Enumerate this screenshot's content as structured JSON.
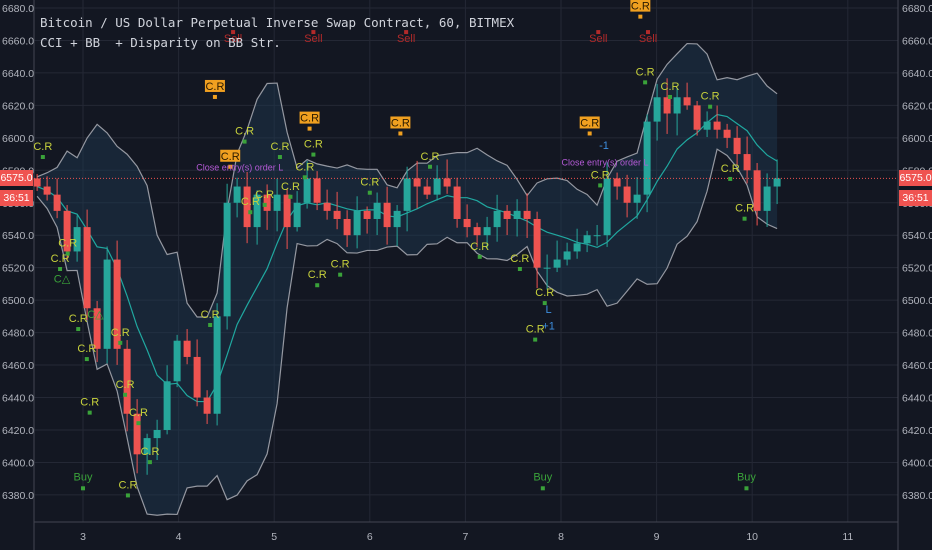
{
  "header": {
    "title": "Bitcoin / US Dollar Perpetual Inverse Swap Contract, 60, BITMEX",
    "indicator": "CCI + BB  + Disparity on BB Str."
  },
  "price_badge": {
    "price": "6575.0",
    "countdown": "36:51"
  },
  "colors": {
    "background": "#131722",
    "grid": "#242835",
    "up": "#26a69a",
    "down": "#ef5350",
    "band": "#9598a1",
    "band_fill": "#1e3a52",
    "basis": "#20a8a0",
    "cr": "#c8d23c",
    "cr_box": "#f0a020",
    "buy": "#3aa23a",
    "sell": "#b32a2a",
    "close_order": "#b45ad6",
    "last_price_line": "#ef5350"
  },
  "chart_data": {
    "type": "candlestick",
    "title": "Bitcoin / US Dollar Perpetual Inverse Swap Contract, 60, BITMEX",
    "xlabel": "",
    "ylabel": "",
    "ylim": [
      6370,
      6690
    ],
    "xlim": [
      2.52,
      11.6
    ],
    "y_ticks": [
      "6380.0",
      "6400.0",
      "6420.0",
      "6440.0",
      "6460.0",
      "6480.0",
      "6500.0",
      "6520.0",
      "6540.0",
      "6560.0",
      "6580.0",
      "6600.0",
      "6620.0",
      "6640.0",
      "6660.0",
      "6680.0"
    ],
    "x_ticks": [
      "3",
      "4",
      "5",
      "6",
      "7",
      "8",
      "9",
      "10",
      "11"
    ],
    "grid": true,
    "start_day": 2.52,
    "step_day": 0.1046,
    "first_open": 6575,
    "closes": [
      6570,
      6565,
      6555,
      6530,
      6545,
      6495,
      6470,
      6525,
      6470,
      6430,
      6405,
      6415,
      6420,
      6450,
      6475,
      6465,
      6440,
      6430,
      6490,
      6560,
      6570,
      6545,
      6565,
      6555,
      6565,
      6545,
      6560,
      6575,
      6560,
      6555,
      6550,
      6540,
      6555,
      6550,
      6560,
      6545,
      6555,
      6575,
      6570,
      6565,
      6575,
      6570,
      6550,
      6545,
      6540,
      6545,
      6555,
      6550,
      6555,
      6550,
      6520,
      6520,
      6525,
      6530,
      6535,
      6540,
      6540,
      6575,
      6570,
      6560,
      6565,
      6610,
      6625,
      6615,
      6625,
      6620,
      6605,
      6610,
      6605,
      6600,
      6590,
      6580,
      6555,
      6570,
      6575
    ],
    "bollinger": {
      "period": 8,
      "mult": 2
    },
    "last_price": 6575.0,
    "annotations": [
      {
        "type": "cr",
        "text": "C.R",
        "day": 2.58,
        "price": 6592.5
      },
      {
        "type": "cr",
        "text": "C.R",
        "day": 3.07,
        "price": 6435
      },
      {
        "type": "cr",
        "text": "C.R",
        "day": 2.76,
        "price": 6523.5
      },
      {
        "type": "cr",
        "text": "C.R",
        "day": 2.84,
        "price": 6533
      },
      {
        "type": "cr",
        "text": "C.R",
        "day": 3.04,
        "price": 6468
      },
      {
        "type": "cr",
        "text": "C.R",
        "day": 2.95,
        "price": 6486.5
      },
      {
        "type": "cr",
        "text": "C.R",
        "day": 3.39,
        "price": 6478
      },
      {
        "type": "cr",
        "text": "C.R",
        "day": 3.44,
        "price": 6446
      },
      {
        "type": "cr",
        "text": "C.R",
        "day": 3.58,
        "price": 6428.5
      },
      {
        "type": "cr",
        "text": "C.R",
        "day": 3.7,
        "price": 6404.5
      },
      {
        "type": "cr",
        "text": "C.R",
        "day": 3.47,
        "price": 6384
      },
      {
        "type": "cr",
        "text": "C.R",
        "day": 4.69,
        "price": 6602
      },
      {
        "type": "cr",
        "text": "C.R",
        "day": 5.06,
        "price": 6592.5
      },
      {
        "type": "cr",
        "text": "C.R",
        "day": 5.41,
        "price": 6594
      },
      {
        "type": "cr",
        "text": "C.R",
        "day": 5.45,
        "price": 6513.5
      },
      {
        "type": "cr",
        "text": "C.R",
        "day": 5.69,
        "price": 6520
      },
      {
        "type": "cr",
        "text": "C.R",
        "day": 6.0,
        "price": 6570.5
      },
      {
        "type": "cr",
        "text": "C.R",
        "day": 6.63,
        "price": 6586.5
      },
      {
        "type": "cr",
        "text": "C.R",
        "day": 7.15,
        "price": 6531
      },
      {
        "type": "cr",
        "text": "C.R",
        "day": 7.73,
        "price": 6480
      },
      {
        "type": "cr",
        "text": "C.R",
        "day": 7.83,
        "price": 6502.5
      },
      {
        "type": "cr",
        "text": "C.R",
        "day": 7.57,
        "price": 6523.5
      },
      {
        "type": "cr",
        "text": "C.R",
        "day": 9.77,
        "price": 6579
      },
      {
        "type": "cr",
        "text": "C.R",
        "day": 9.92,
        "price": 6554.5
      },
      {
        "type": "cr",
        "text": "C.R",
        "day": 9.14,
        "price": 6629.5
      },
      {
        "type": "cr",
        "text": "C.R",
        "day": 9.56,
        "price": 6623.5
      },
      {
        "type": "cr",
        "text": "C.R",
        "day": 8.88,
        "price": 6638.5
      },
      {
        "type": "cr",
        "text": "C.R",
        "day": 8.41,
        "price": 6575
      },
      {
        "type": "cr",
        "text": "C.R",
        "day": 4.9,
        "price": 6563
      },
      {
        "type": "cr",
        "text": "C.R",
        "day": 5.17,
        "price": 6568
      },
      {
        "type": "cr",
        "text": "C.R",
        "day": 4.33,
        "price": 6489
      },
      {
        "type": "cr",
        "text": "C.R",
        "day": 4.75,
        "price": 6558.5
      },
      {
        "type": "cr",
        "text": "C.R",
        "day": 5.32,
        "price": 6580
      },
      {
        "type": "crbox",
        "text": "C.R",
        "day": 4.38,
        "price": 6629.5
      },
      {
        "type": "crbox",
        "text": "C.R",
        "day": 5.37,
        "price": 6610
      },
      {
        "type": "crbox",
        "text": "C.R",
        "day": 6.32,
        "price": 6607
      },
      {
        "type": "crbox",
        "text": "C.R",
        "day": 8.3,
        "price": 6607
      },
      {
        "type": "crbox",
        "text": "C.R",
        "day": 8.83,
        "price": 6679
      },
      {
        "type": "crbox",
        "text": "C.R",
        "day": 4.54,
        "price": 6586.5
      },
      {
        "type": "sell",
        "text": "Sell",
        "day": 4.57,
        "price": 6659
      },
      {
        "type": "sell",
        "text": "Sell",
        "day": 5.41,
        "price": 6659
      },
      {
        "type": "sell",
        "text": "Sell",
        "day": 6.38,
        "price": 6659
      },
      {
        "type": "sell",
        "text": "Sell",
        "day": 8.39,
        "price": 6659
      },
      {
        "type": "sell",
        "text": "Sell",
        "day": 8.91,
        "price": 6659
      },
      {
        "type": "buy",
        "text": "Buy",
        "day": 3.0,
        "price": 6389
      },
      {
        "type": "buy",
        "text": "Buy",
        "day": 7.81,
        "price": 6389
      },
      {
        "type": "buy",
        "text": "Buy",
        "day": 9.94,
        "price": 6389
      },
      {
        "type": "ctri",
        "text": "C△",
        "day": 2.78,
        "price": 6511
      },
      {
        "type": "ctri",
        "text": "C△",
        "day": 3.13,
        "price": 6489
      },
      {
        "type": "close",
        "text": "Close entry(s) order L",
        "day": 4.64,
        "price": 6580
      },
      {
        "type": "close",
        "text": "Close entry(s) order L",
        "day": 8.46,
        "price": 6583
      },
      {
        "type": "pos",
        "text": "L",
        "day": 7.87,
        "price": 6492
      },
      {
        "type": "pos",
        "text": "+1",
        "day": 7.87,
        "price": 6482
      },
      {
        "type": "neg",
        "text": "-1",
        "day": 8.45,
        "price": 6593
      }
    ]
  }
}
